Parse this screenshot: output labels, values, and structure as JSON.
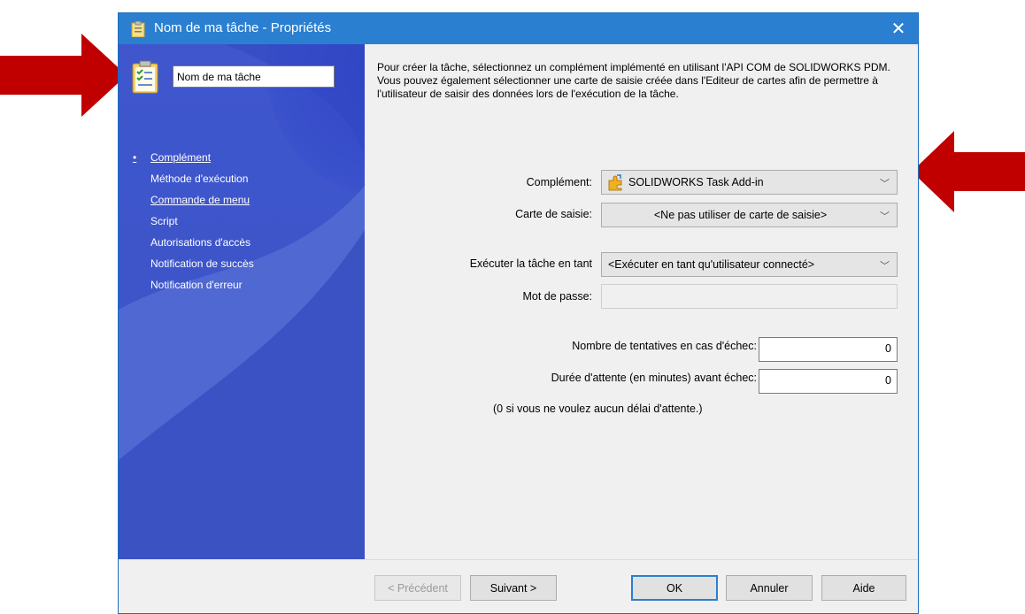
{
  "window": {
    "title": "Nom de ma tâche - Propriétés",
    "close_label": "✕"
  },
  "left_panel": {
    "task_name": "Nom de ma tâche",
    "nav_items": [
      {
        "label": "Complément",
        "selected": true,
        "link": true
      },
      {
        "label": "Méthode d'exécution",
        "selected": false,
        "link": false
      },
      {
        "label": "Commande de menu",
        "selected": false,
        "link": true
      },
      {
        "label": "Script",
        "selected": false,
        "link": false
      },
      {
        "label": "Autorisations d'accès",
        "selected": false,
        "link": false
      },
      {
        "label": "Notification de succès",
        "selected": false,
        "link": false
      },
      {
        "label": "Notification d'erreur",
        "selected": false,
        "link": false
      }
    ],
    "bullet": "•"
  },
  "main": {
    "description": "Pour créer la tâche, sélectionnez un complément implémenté en utilisant l'API COM de SOLIDWORKS PDM. Vous pouvez également sélectionner une carte de saisie créée dans l'Editeur de cartes afin de permettre à l'utilisateur de saisir des données lors de l'exécution de la tâche.",
    "addin_label": "Complément:",
    "addin_value": "SOLIDWORKS Task Add-in",
    "card_label": "Carte de saisie:",
    "card_value": "<Ne pas utiliser de carte de saisie>",
    "run_as_label": "Exécuter la tâche en tant",
    "run_as_value": "<Exécuter en tant qu'utilisateur connecté>",
    "password_label": "Mot de passe:",
    "password_value": "",
    "retries_label": "Nombre de tentatives en cas d'échec:",
    "retries_value": "0",
    "timeout_label": "Durée d'attente (en minutes) avant échec:",
    "timeout_value": "0",
    "timeout_hint": "(0 si vous ne voulez aucun délai d'attente.)"
  },
  "buttons": {
    "previous": "< Précédent",
    "next": "Suivant >",
    "ok": "OK",
    "cancel": "Annuler",
    "help": "Aide"
  },
  "colors": {
    "titlebar": "#2b7fd0",
    "left_panel": "#3c54c8",
    "annotation_arrow": "#c00000"
  }
}
